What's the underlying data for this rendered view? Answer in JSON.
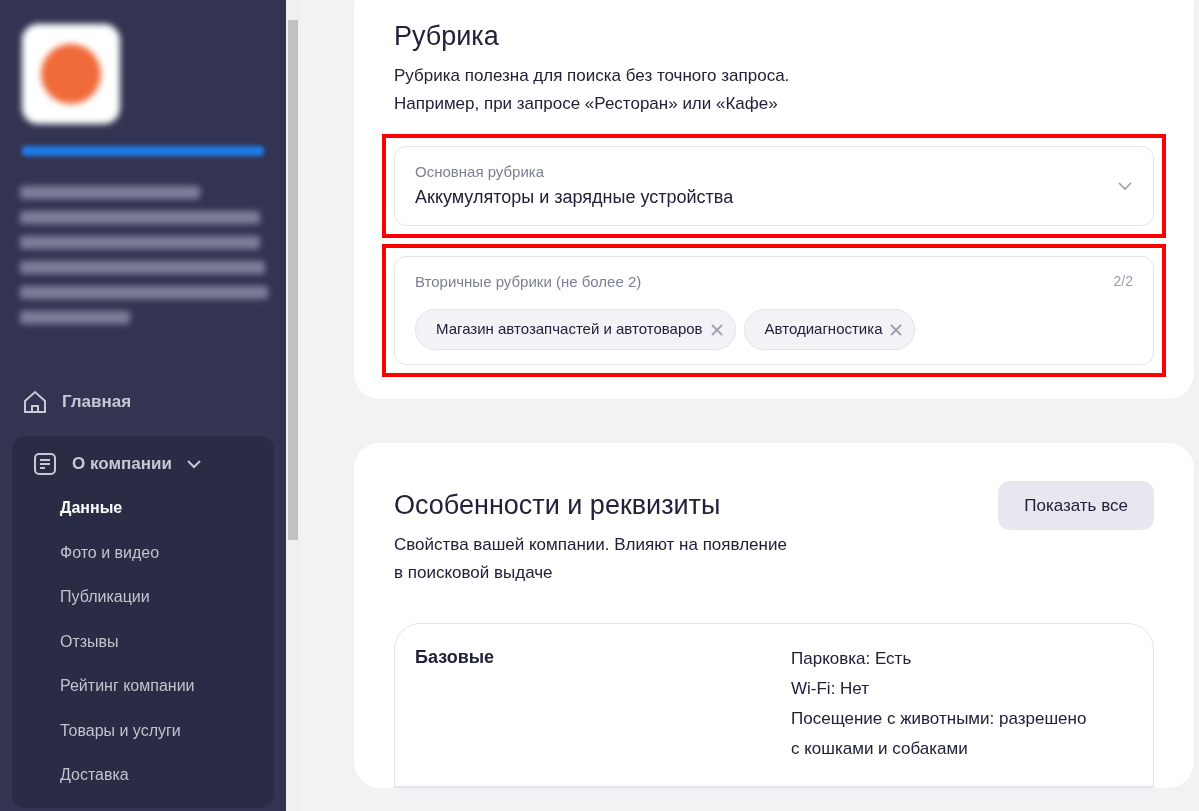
{
  "sidebar": {
    "nav": [
      {
        "label": "Главная",
        "kind": "link"
      },
      {
        "label": "О компании",
        "kind": "group",
        "expanded": true,
        "children": [
          {
            "label": "Данные",
            "selected": true
          },
          {
            "label": "Фото и видео",
            "selected": false
          },
          {
            "label": "Публикации",
            "selected": false
          },
          {
            "label": "Отзывы",
            "selected": false
          },
          {
            "label": "Рейтинг компании",
            "selected": false
          },
          {
            "label": "Товары и услуги",
            "selected": false
          },
          {
            "label": "Доставка",
            "selected": false
          }
        ]
      }
    ]
  },
  "rubric": {
    "title": "Рубрика",
    "description": [
      "Рубрика полезна для поиска без точного запроса.",
      "Например, при запросе «Ресторан» или «Кафе»"
    ],
    "main_field": {
      "label": "Основная рубрика",
      "value": "Аккумуляторы и зарядные устройства",
      "highlighted": true
    },
    "secondary_field": {
      "label": "Вторичные рубрики (не более 2)",
      "counter": "2/2",
      "highlighted": true,
      "tags": [
        "Магазин автозапчастей и автотоваров",
        "Автодиагностика"
      ]
    }
  },
  "features": {
    "title": "Особенности и реквизиты",
    "button": "Показать все",
    "description": [
      "Свойства вашей компании. Влияют на появление",
      "в поисковой выдаче"
    ],
    "groups": [
      {
        "name": "Базовые",
        "values": [
          "Парковка: Есть",
          "Wi-Fi: Нет",
          "Посещение с животными: разрешено",
          "с кошками и собаками"
        ]
      }
    ]
  }
}
